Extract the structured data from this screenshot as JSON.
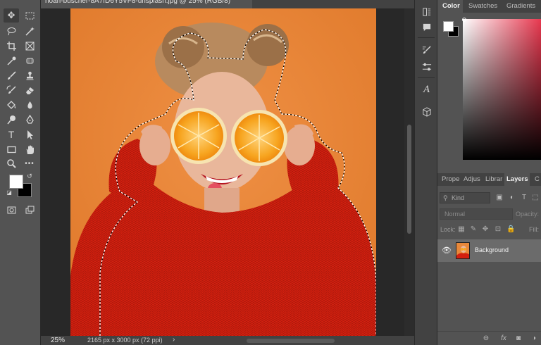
{
  "document": {
    "tab_title": "noah-buscher-8A7fD6Y5VF8-unsplash.jpg @ 25% (RGB/8)",
    "zoom": "25%",
    "info": "2165 px x 3000 px (72 ppi)",
    "info_arrow": "›"
  },
  "toolbar": {
    "tools": [
      {
        "name": "move-tool-icon",
        "glyph": "✥"
      },
      {
        "name": "marquee-tool-icon",
        "glyph": "⬚"
      },
      {
        "name": "lasso-tool-icon",
        "glyph": "ↄ"
      },
      {
        "name": "magic-wand-tool-icon",
        "glyph": "✧"
      },
      {
        "name": "crop-tool-icon",
        "glyph": "⌗"
      },
      {
        "name": "frame-tool-icon",
        "glyph": "⊠"
      },
      {
        "name": "eyedropper-tool-icon",
        "glyph": "⁄"
      },
      {
        "name": "spot-healing-tool-icon",
        "glyph": "⊛"
      },
      {
        "name": "brush-tool-icon",
        "glyph": "∕"
      },
      {
        "name": "stamp-tool-icon",
        "glyph": "⊥"
      },
      {
        "name": "history-brush-tool-icon",
        "glyph": "↺"
      },
      {
        "name": "eraser-tool-icon",
        "glyph": "◇"
      },
      {
        "name": "paint-bucket-tool-icon",
        "glyph": "◆"
      },
      {
        "name": "blur-tool-icon",
        "glyph": "●"
      },
      {
        "name": "dodge-tool-icon",
        "glyph": "●"
      },
      {
        "name": "pen-tool-icon",
        "glyph": "✒"
      },
      {
        "name": "type-tool-icon",
        "glyph": "T"
      },
      {
        "name": "path-selection-tool-icon",
        "glyph": "➤"
      },
      {
        "name": "rectangle-tool-icon",
        "glyph": "▭"
      },
      {
        "name": "hand-tool-icon",
        "glyph": "✋"
      },
      {
        "name": "zoom-tool-icon",
        "glyph": "⚲"
      },
      {
        "name": "more-tools-icon",
        "glyph": "•••"
      }
    ]
  },
  "color_panel": {
    "tabs": [
      "Color",
      "Swatches",
      "Gradients"
    ],
    "active_tab": "Color",
    "foreground": "#ffffff",
    "background": "#000000",
    "hue_color": "#e8384f"
  },
  "layers_panel": {
    "tabs": [
      "Prope",
      "Adjus",
      "Librar",
      "Layers",
      "C"
    ],
    "active_tab": "Layers",
    "kind_placeholder": "Kind",
    "blend_mode": "Normal",
    "opacity_label": "Opacity:",
    "lock_label": "Lock:",
    "fill_label": "Fill:",
    "layers": [
      {
        "name": "Background",
        "visible": true
      }
    ]
  },
  "colors": {
    "photo_bg": "#e8883a",
    "sweater": "#d3200f",
    "accent": "#e0e0e0"
  }
}
